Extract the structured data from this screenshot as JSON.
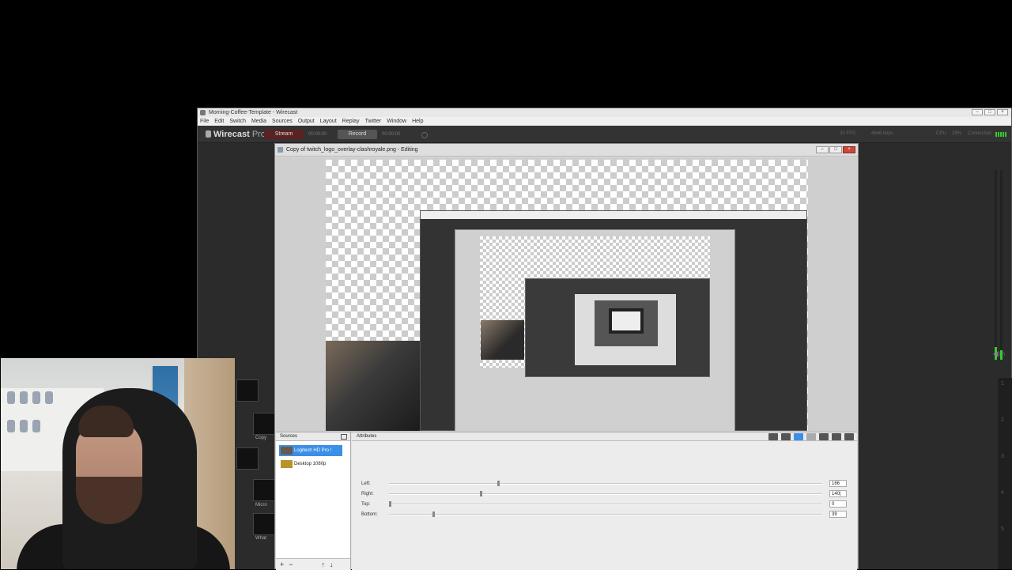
{
  "window": {
    "title": "Morning-Coffee-Template - Wirecast",
    "controls": [
      "–",
      "□",
      "×"
    ]
  },
  "menu": [
    "File",
    "Edit",
    "Switch",
    "Media",
    "Sources",
    "Output",
    "Layout",
    "Replay",
    "Twitter",
    "Window",
    "Help"
  ],
  "toolbar": {
    "brand": "Wirecast",
    "brand_suffix": "Pro",
    "stream_label": "Stream",
    "stream_time": "00:00:00",
    "record_label": "Record",
    "record_time": "00:00:00",
    "fps": "30 FPS",
    "bitrate": "4646 kbps",
    "cpu_label": "CPU",
    "cpu_value": "19%",
    "connection_label": "Connection"
  },
  "editor": {
    "title": "Copy of twitch_logo_overlay-clashroyale.png - Editing",
    "controls": [
      "–",
      "□",
      "×"
    ],
    "sources_header": "Sources",
    "attributes_header": "Attributes",
    "sources": [
      {
        "label": "Logitech HD Pro !",
        "selected": true
      },
      {
        "label": "Desktop 1080p",
        "selected": false
      }
    ],
    "footer_buttons": [
      "+",
      "−",
      "↑",
      "↓"
    ],
    "crop": [
      {
        "label": "Left:",
        "value": "166",
        "pos": 0.25
      },
      {
        "label": "Right:",
        "value": "140|",
        "pos": 0.21
      },
      {
        "label": "Top:",
        "value": "0",
        "pos": 0.0
      },
      {
        "label": "Bottom:",
        "value": "39",
        "pos": 0.1
      }
    ],
    "tool_icons": [
      "layers-icon",
      "chat-icon",
      "crop-icon",
      "text-icon",
      "person-icon",
      "split-icon",
      "audio-icon"
    ]
  },
  "shots": [
    {
      "label": "Copy"
    },
    {
      "label": "Micro"
    },
    {
      "label": "What"
    }
  ],
  "right_layers": [
    "1",
    "2",
    "3",
    "4",
    "5"
  ],
  "colors": {
    "accent": "#3b8fe6",
    "meter": "#33cc33",
    "stream": "#7a2020"
  }
}
